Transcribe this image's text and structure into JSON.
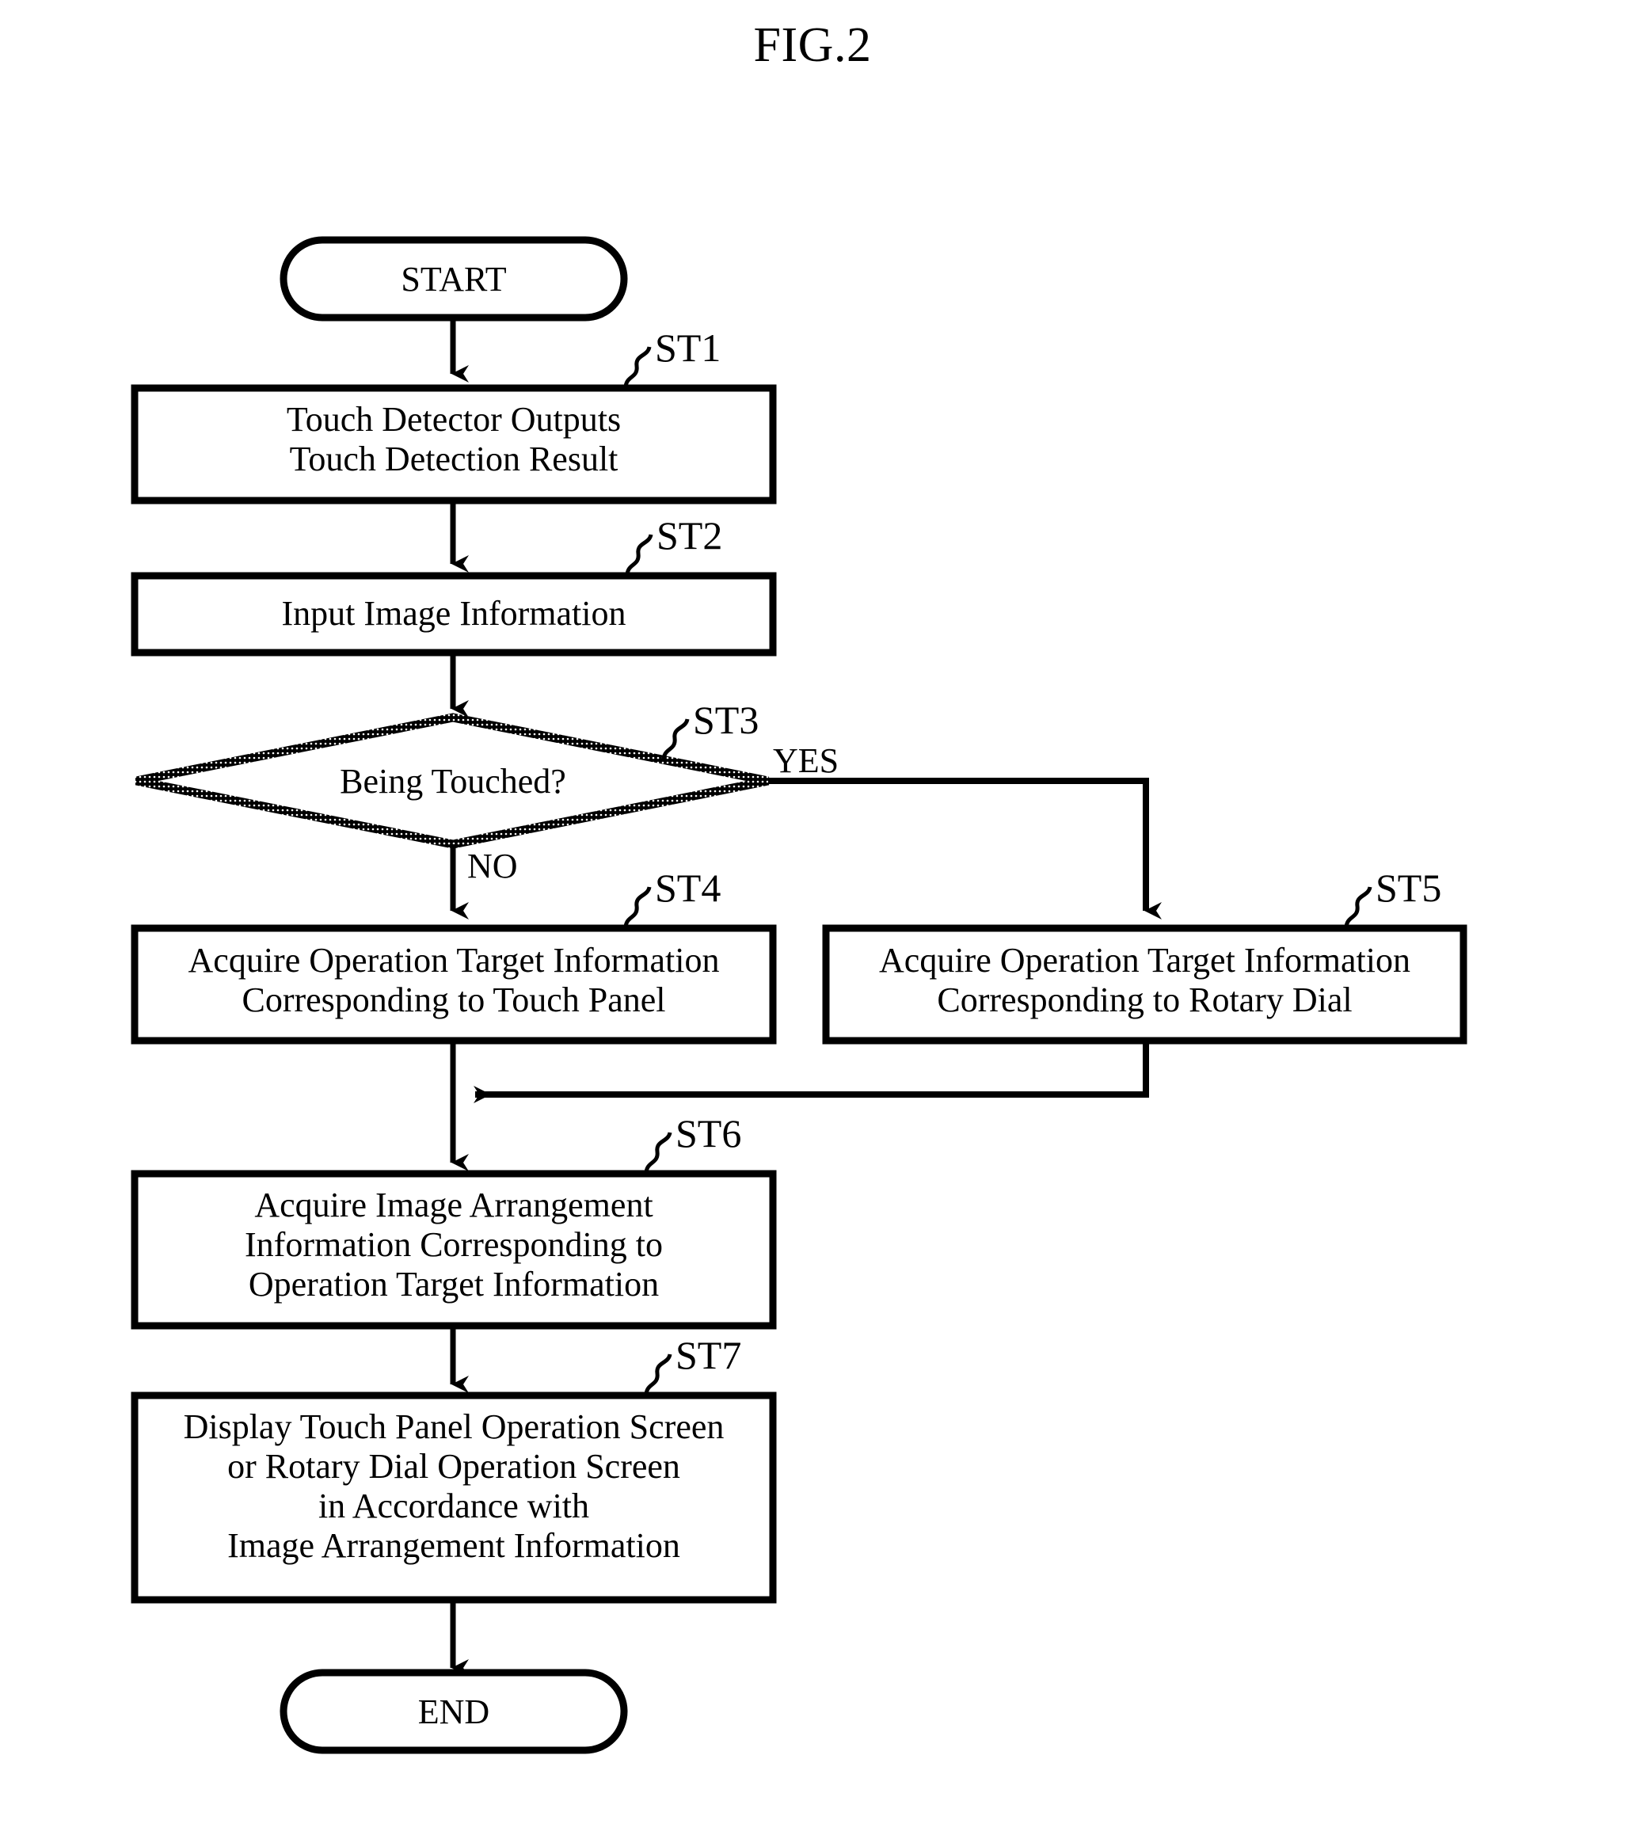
{
  "figure": {
    "title": "FIG.2",
    "type": "patent-flowchart"
  },
  "nodes": {
    "start": {
      "label": "START",
      "shape": "terminator"
    },
    "end": {
      "label": "END",
      "shape": "terminator"
    },
    "st1": {
      "tag": "ST1",
      "shape": "process",
      "label": "Touch Detector Outputs\nTouch Detection Result"
    },
    "st2": {
      "tag": "ST2",
      "shape": "process",
      "label": "Input Image Information"
    },
    "st3": {
      "tag": "ST3",
      "shape": "decision",
      "label": "Being Touched?"
    },
    "st4": {
      "tag": "ST4",
      "shape": "process",
      "label": "Acquire Operation Target Information\nCorresponding to Touch Panel"
    },
    "st5": {
      "tag": "ST5",
      "shape": "process",
      "label": "Acquire Operation Target Information\nCorresponding to Rotary Dial"
    },
    "st6": {
      "tag": "ST6",
      "shape": "process",
      "label": "Acquire Image Arrangement\nInformation Corresponding to\nOperation Target Information"
    },
    "st7": {
      "tag": "ST7",
      "shape": "process",
      "label": "Display Touch Panel Operation Screen\nor Rotary Dial Operation Screen\nin Accordance with\nImage Arrangement Information"
    }
  },
  "branches": {
    "yes": "YES",
    "no": "NO"
  },
  "colors": {
    "stroke": "#000000",
    "fill": "#ffffff",
    "background": "#ffffff"
  }
}
